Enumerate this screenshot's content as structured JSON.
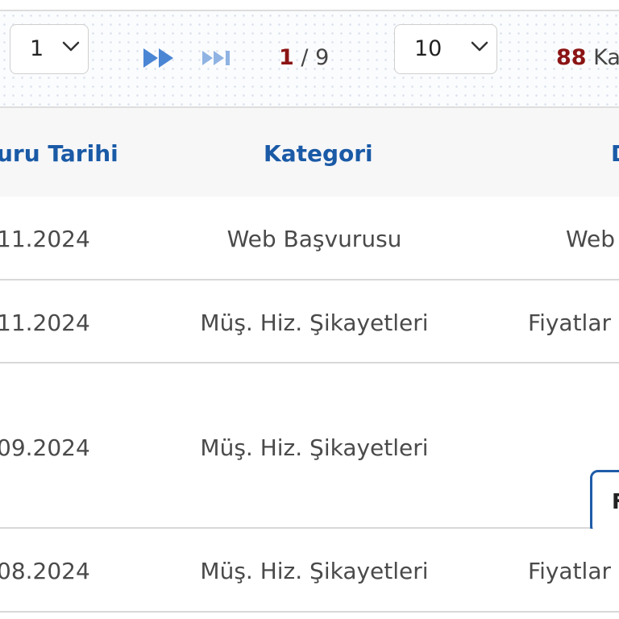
{
  "pagination": {
    "page_select_value": "1",
    "current_page": "1",
    "page_separator": " / ",
    "total_pages": "9",
    "page_size_value": "10",
    "record_count": "88",
    "record_label": "Ka"
  },
  "table": {
    "headers": {
      "date": "uru Tarihi",
      "category": "Kategori",
      "description": "D"
    },
    "rows": [
      {
        "date": "11.2024",
        "category": "Web Başvurusu",
        "description": "Web"
      },
      {
        "date": "11.2024",
        "category": "Müş. Hiz. Şikayetleri",
        "description": "Fiyatlar"
      },
      {
        "date": "09.2024",
        "category": "Müş. Hiz. Şikayetleri",
        "description": "",
        "action_label": "F"
      },
      {
        "date": "08.2024",
        "category": "Müş. Hiz. Şikayetleri",
        "description": "Fiyatlar"
      }
    ]
  },
  "colors": {
    "accent_blue": "#1a5aa6",
    "highlight_red": "#8b1414",
    "nav_icon_blue": "#4a86d4"
  },
  "icons": [
    "chevron-down-icon",
    "fast-forward-icon",
    "last-page-icon"
  ]
}
